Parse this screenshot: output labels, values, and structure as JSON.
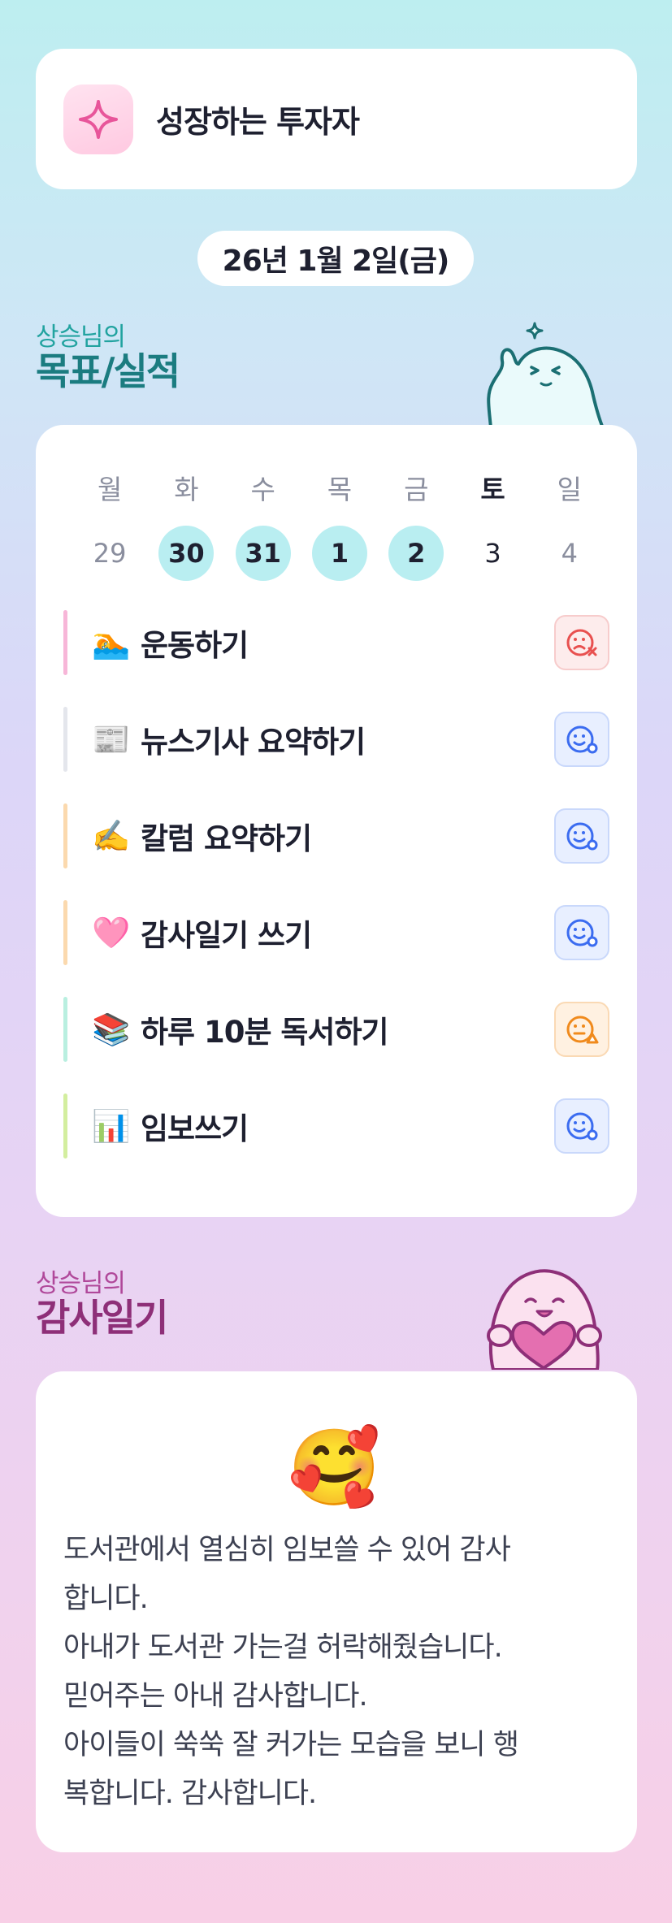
{
  "profile": {
    "name": "성장하는 투자자",
    "icon": "sparkle-icon"
  },
  "date_label": "26년 1월 2일(금)",
  "goals_section": {
    "subtitle": "상승님의",
    "title": "목표/실적"
  },
  "week": {
    "weekdays": [
      "월",
      "화",
      "수",
      "목",
      "금",
      "토",
      "일"
    ],
    "days": [
      {
        "num": "29",
        "done": false
      },
      {
        "num": "30",
        "done": true
      },
      {
        "num": "31",
        "done": true
      },
      {
        "num": "1",
        "done": true
      },
      {
        "num": "2",
        "done": true
      },
      {
        "num": "3",
        "done": false
      },
      {
        "num": "4",
        "done": false
      }
    ]
  },
  "goals": [
    {
      "emoji": "🏊",
      "label": "운동하기",
      "status": "fail",
      "color": "#f7b6d8"
    },
    {
      "emoji": "📰",
      "label": "뉴스기사 요약하기",
      "status": "good",
      "color": "#e4e6ec"
    },
    {
      "emoji": "✍️",
      "label": "칼럼 요약하기",
      "status": "good",
      "color": "#fbd9ae"
    },
    {
      "emoji": "🩷",
      "label": "감사일기 쓰기",
      "status": "good",
      "color": "#fbd9ae"
    },
    {
      "emoji": "📚",
      "label": "하루 10분 독서하기",
      "status": "warn",
      "color": "#b9efe0"
    },
    {
      "emoji": "📊",
      "label": "임보쓰기",
      "status": "good",
      "color": "#d3ee9f"
    }
  ],
  "diary_section": {
    "subtitle": "상승님의",
    "title": "감사일기"
  },
  "diary": {
    "emoji": "🥰",
    "lines": [
      "도서관에서 열심히 임보쓸 수 있어 감사",
      "합니다.",
      "아내가 도서관 가는걸 허락해줬습니다.",
      "믿어주는 아내 감사합니다.",
      "아이들이 쑥쑥 잘 커가는 모습을 보니 행",
      "복합니다. 감사합니다."
    ]
  },
  "colors": {
    "accent_teal": "#1b7c80",
    "accent_pink": "#8e2f78",
    "done_circle": "#b9eef1",
    "fail": "#e8504f",
    "good": "#3b6cf0",
    "warn": "#f08a1c"
  }
}
